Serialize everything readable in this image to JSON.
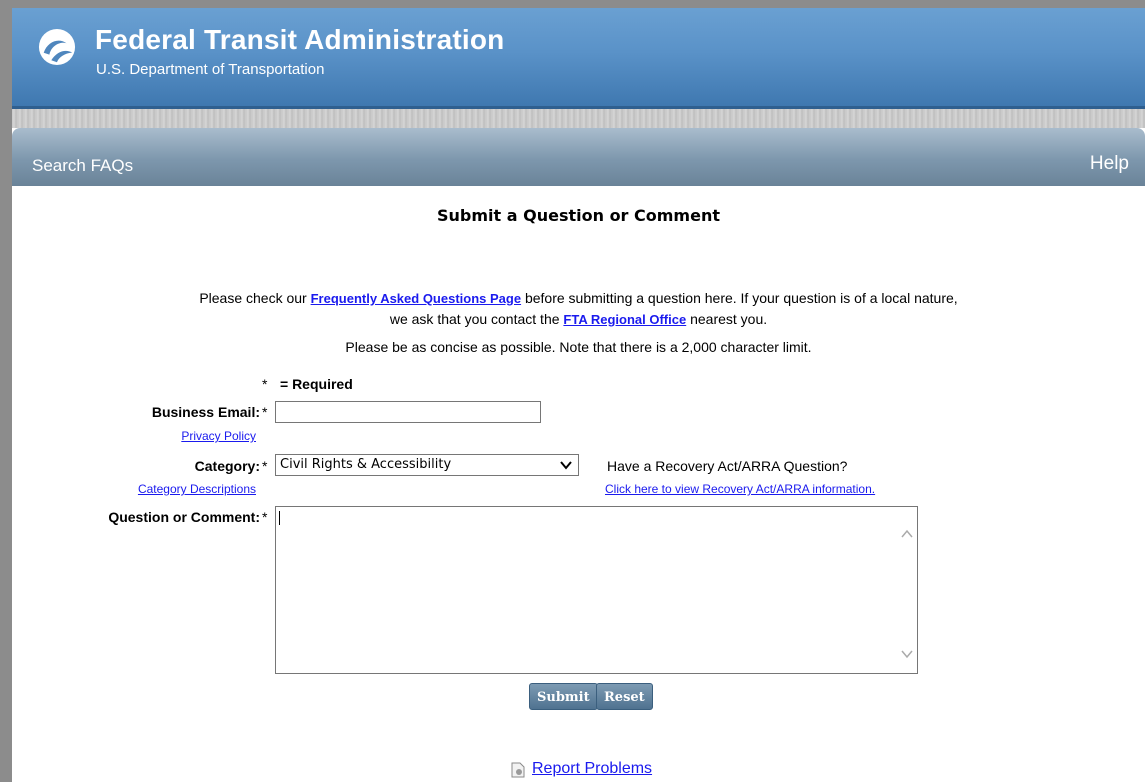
{
  "header": {
    "title": "Federal Transit Administration",
    "subtitle": "U.S. Department of Transportation"
  },
  "nav": {
    "left": "Search FAQs",
    "right": "Help"
  },
  "form": {
    "title": "Submit a Question or Comment",
    "intro_1": "Please check our ",
    "faq_link": "Frequently Asked Questions Page",
    "intro_2": " before submitting a question here. If your question is of a local nature,",
    "intro_3": "we ask that you contact the ",
    "regional_link": "FTA Regional Office",
    "intro_4": " nearest you.",
    "concise": "Please be as concise as possible. Note that there is a 2,000 character limit.",
    "required_star": "*",
    "required_text": "= Required",
    "email_label": "Business Email:",
    "email_value": "",
    "privacy_link": "Privacy Policy",
    "category_label": "Category:",
    "category_value": "Civil Rights & Accessibility",
    "category_desc_link": "Category Descriptions",
    "arra_question": "Have a Recovery Act/ARRA Question?",
    "arra_link": "Click here to view Recovery Act/ARRA information.",
    "question_label": "Question or Comment:",
    "question_value": "",
    "submit_label": "Submit",
    "reset_label": "Reset",
    "star": "*"
  },
  "footer": {
    "report_link": "Report Problems"
  },
  "colors": {
    "header_blue": "#4f86bd",
    "nav_gray_blue": "#7d97ad",
    "link": "#1a1aee",
    "button": "#5b7b97"
  },
  "icons": [
    "dot-logo-icon",
    "chevron-down-icon",
    "scroll-up-icon",
    "scroll-down-icon",
    "report-document-icon"
  ]
}
